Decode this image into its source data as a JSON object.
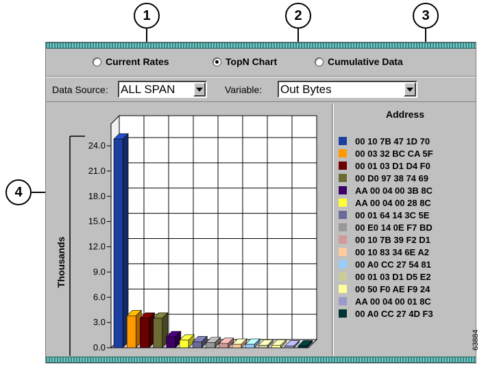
{
  "callouts": [
    "1",
    "2",
    "3",
    "4"
  ],
  "view_options": [
    {
      "label": "Current Rates",
      "selected": false
    },
    {
      "label": "TopN Chart",
      "selected": true
    },
    {
      "label": "Cumulative Data",
      "selected": false
    }
  ],
  "controls": {
    "data_source_label": "Data Source:",
    "data_source_value": "ALL SPAN",
    "variable_label": "Variable:",
    "variable_value": "Out Bytes"
  },
  "chart_data": {
    "type": "bar",
    "ylabel": "Thousands",
    "ylim": [
      0,
      25
    ],
    "yticks": [
      "24.0",
      "21.0",
      "18.0",
      "15.0",
      "12.0",
      "9.0",
      "6.0",
      "3.0",
      "0.0"
    ],
    "categories": [
      "00 10 7B 47 1D 70",
      "00 03 32 BC CA 5F",
      "00 01 03 D1 D4 F0",
      "00 D0 97 38 74 69",
      "AA 00 04 00 3B 8C",
      "AA 00 04 00 28 8C",
      "00 01 64 14 3C 5E",
      "00 E0 14 0E F7 BD",
      "00 10 7B 39 F2 D1",
      "00 10 83 34 6E A2",
      "00 A0 CC 27 54 81",
      "00 01 03 D1 D5 E2",
      "00 50 F0 AE F9 24",
      "AA 00 04 00 01 8C",
      "00 A0 CC 27 4D F3"
    ],
    "values": [
      24.8,
      3.8,
      3.5,
      3.5,
      1.3,
      0.9,
      0.7,
      0.6,
      0.5,
      0.4,
      0.4,
      0.3,
      0.3,
      0.2,
      0.2
    ],
    "colors": [
      "#1c3fa0",
      "#ff9900",
      "#6b0000",
      "#6b6b33",
      "#3d0066",
      "#ffff33",
      "#6b6b99",
      "#999999",
      "#d19999",
      "#ffcc99",
      "#99ccff",
      "#cccc99",
      "#ffff99",
      "#9999cc",
      "#003333"
    ]
  },
  "legend": {
    "title": "Address"
  },
  "figure_id": "63884"
}
